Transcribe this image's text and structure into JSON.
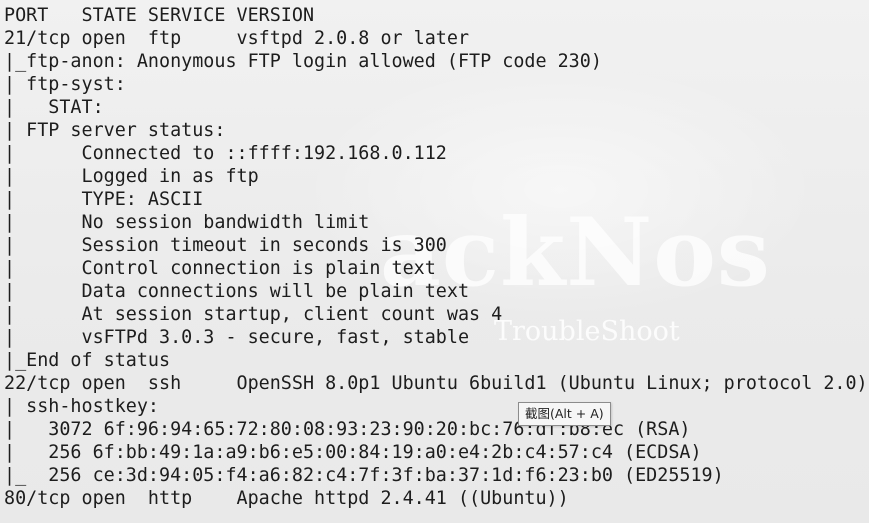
{
  "terminal": {
    "lines": [
      "PORT   STATE SERVICE VERSION",
      "21/tcp open  ftp     vsftpd 2.0.8 or later",
      "|_ftp-anon: Anonymous FTP login allowed (FTP code 230)",
      "| ftp-syst: ",
      "|   STAT: ",
      "| FTP server status:",
      "|      Connected to ::ffff:192.168.0.112",
      "|      Logged in as ftp",
      "|      TYPE: ASCII",
      "|      No session bandwidth limit",
      "|      Session timeout in seconds is 300",
      "|      Control connection is plain text",
      "|      Data connections will be plain text",
      "|      At session startup, client count was 4",
      "|      vsFTPd 3.0.3 - secure, fast, stable",
      "|_End of status",
      "22/tcp open  ssh     OpenSSH 8.0p1 Ubuntu 6build1 (Ubuntu Linux; protocol 2.0)",
      "| ssh-hostkey: ",
      "|   3072 6f:96:94:65:72:80:08:93:23:90:20:bc:76:df:b8:ec (RSA)",
      "|   256 6f:bb:49:1a:a9:b6:e5:00:84:19:a0:e4:2b:c4:57:c4 (ECDSA)",
      "|_  256 ce:3d:94:05:f4:a6:82:c4:7f:3f:ba:37:1d:f6:23:b0 (ED25519)",
      "80/tcp open  http    Apache httpd 2.4.41 ((Ubuntu))"
    ]
  },
  "watermark": {
    "title": "ackNos",
    "subtitle": "TroubleShoot"
  },
  "tooltip": {
    "text": "截图(Alt + A)"
  }
}
